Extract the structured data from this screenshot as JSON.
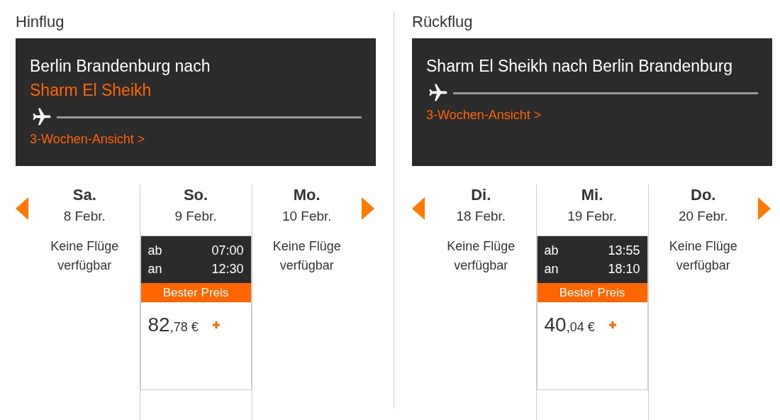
{
  "legs": [
    {
      "heading": "Hinflug",
      "route": [
        {
          "text": "Berlin Brandenburg nach",
          "highlighted": false
        },
        {
          "text": "Sharm El Sheikh",
          "highlighted": true
        }
      ],
      "link": "3-Wochen-Ansicht >",
      "days": [
        {
          "kind": "empty",
          "weekday": "Sa.",
          "date": "8 Febr.",
          "message": "Keine Flüge verfügbar"
        },
        {
          "kind": "flight",
          "weekday": "So.",
          "date": "9 Febr.",
          "dep_label": "ab",
          "dep_time": "07:00",
          "arr_label": "an",
          "arr_time": "12:30",
          "badge": "Bester Preis",
          "price_main": "82",
          "price_rest": ",78 €"
        },
        {
          "kind": "empty",
          "weekday": "Mo.",
          "date": "10 Febr.",
          "message": "Keine Flüge verfügbar"
        }
      ]
    },
    {
      "heading": "Rückflug",
      "route": [
        {
          "text": "Sharm El Sheikh nach Berlin Brandenburg",
          "highlighted": false
        }
      ],
      "link": "3-Wochen-Ansicht >",
      "days": [
        {
          "kind": "empty",
          "weekday": "Di.",
          "date": "18 Febr.",
          "message": "Keine Flüge verfügbar"
        },
        {
          "kind": "flight",
          "weekday": "Mi.",
          "date": "19 Febr.",
          "dep_label": "ab",
          "dep_time": "13:55",
          "arr_label": "an",
          "arr_time": "18:10",
          "badge": "Bester Preis",
          "price_main": "40",
          "price_rest": ",04 €"
        },
        {
          "kind": "empty",
          "weekday": "Do.",
          "date": "20 Febr.",
          "message": "Keine Flüge verfügbar"
        }
      ]
    }
  ]
}
